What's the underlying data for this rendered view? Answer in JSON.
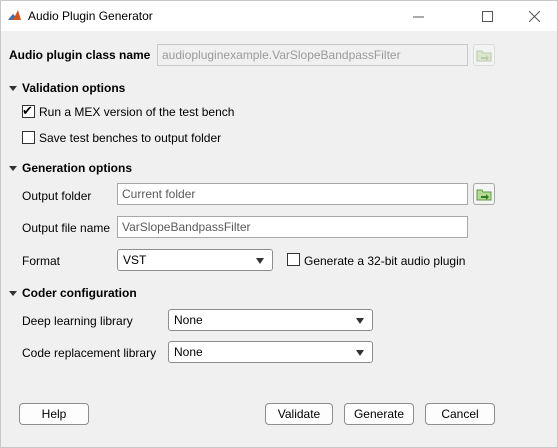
{
  "window": {
    "title": "Audio Plugin Generator"
  },
  "class_name": {
    "label": "Audio plugin class name",
    "value": "audiopluginexample.VarSlopeBandpassFilter"
  },
  "validation": {
    "heading": "Validation options",
    "run_mex_label": "Run a MEX version of the test bench",
    "run_mex_checked": true,
    "save_tb_label": "Save test benches to output folder",
    "save_tb_checked": false
  },
  "generation": {
    "heading": "Generation options",
    "output_folder_label": "Output folder",
    "output_folder_value": "Current folder",
    "output_file_label": "Output file name",
    "output_file_value": "VarSlopeBandpassFilter",
    "format_label": "Format",
    "format_value": "VST",
    "gen32_label": "Generate a 32-bit audio plugin",
    "gen32_checked": false
  },
  "coder": {
    "heading": "Coder configuration",
    "dl_label": "Deep learning library",
    "dl_value": "None",
    "cr_label": "Code replacement library",
    "cr_value": "None"
  },
  "buttons": {
    "help": "Help",
    "validate": "Validate",
    "generate": "Generate",
    "cancel": "Cancel"
  },
  "colors": {
    "background": "#f0f0f0",
    "titlebar": "#ffffff",
    "folder_icon": "#5a9e3a"
  }
}
